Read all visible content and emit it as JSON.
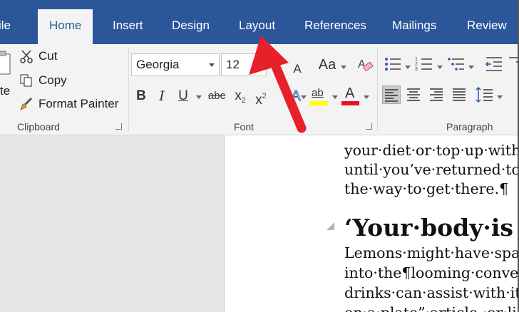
{
  "tabs": [
    {
      "label": "ile"
    },
    {
      "label": "Home"
    },
    {
      "label": "Insert"
    },
    {
      "label": "Design"
    },
    {
      "label": "Layout"
    },
    {
      "label": "References"
    },
    {
      "label": "Mailings"
    },
    {
      "label": "Review"
    }
  ],
  "clipboard": {
    "paste_stub": "te",
    "cut": "Cut",
    "copy": "Copy",
    "format_painter": "Format Painter",
    "group_label": "Clipboard"
  },
  "font": {
    "family": "Georgia",
    "size": "12",
    "grow": "A",
    "shrink": "A",
    "change_case": "Aa",
    "bold": "B",
    "italic": "I",
    "underline": "U",
    "strikethrough": "abc",
    "subscript": "x",
    "subscript_mark": "2",
    "superscript": "x",
    "superscript_mark": "2",
    "highlight": "ab",
    "font_color": "A",
    "group_label": "Font",
    "highlight_color": "#ffff00",
    "font_color_value": "#e81123"
  },
  "paragraph": {
    "group_label": "Paragraph"
  },
  "document": {
    "lines": [
      "your·diet·or·top·up·with",
      "until·you’ve·returned·to",
      "the·way·to·get·there.¶",
      "Lemons·might·have·spa",
      "into·the¶looming·conver",
      "drinks·can·assist·with·it",
      "on·a·plate”·article,·or·lic"
    ],
    "heading": "‘Your·body·is"
  },
  "colors": {
    "tab_bar": "#2b579a",
    "ribbon": "#f3f3f3",
    "annotation_arrow": "#e8202a"
  }
}
